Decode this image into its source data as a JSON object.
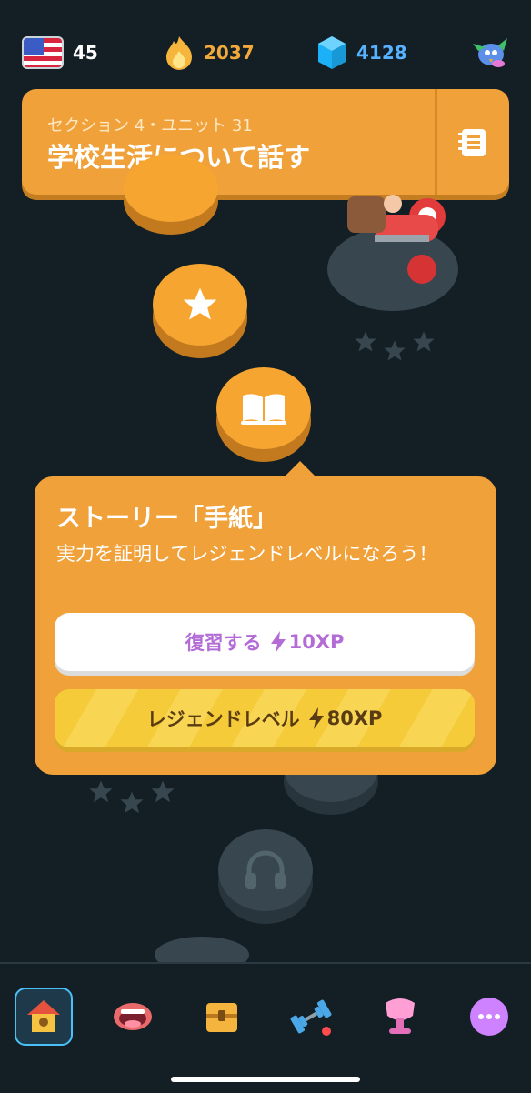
{
  "status": {
    "language_count": "45",
    "streak": "2037",
    "gems": "4128"
  },
  "unit": {
    "section_label": "セクション 4・ユニット 31",
    "title": "学校生活について話す"
  },
  "popup": {
    "title": "ストーリー「手紙」",
    "description": "実力を証明してレジェンドレベルになろう！",
    "review_button": "復習する",
    "review_xp": "10XP",
    "legend_button": "レジェンドレベル",
    "legend_xp": "80XP"
  },
  "colors": {
    "background": "#131f24",
    "unit_orange": "#f0a13a",
    "gem_blue": "#57b2ff",
    "streak_gold": "#f0a93a",
    "legend_yellow": "#f5cb3a",
    "review_purple": "#b36bd6"
  },
  "icons": {
    "language": "us-flag-icon",
    "streak": "streak-flame-icon",
    "gems": "gem-icon",
    "mascot": "mascot-icon",
    "guide": "guidebook-icon",
    "nav": [
      "home-icon",
      "speak-icon",
      "treasure-icon",
      "practice-icon",
      "league-icon",
      "more-icon"
    ]
  }
}
